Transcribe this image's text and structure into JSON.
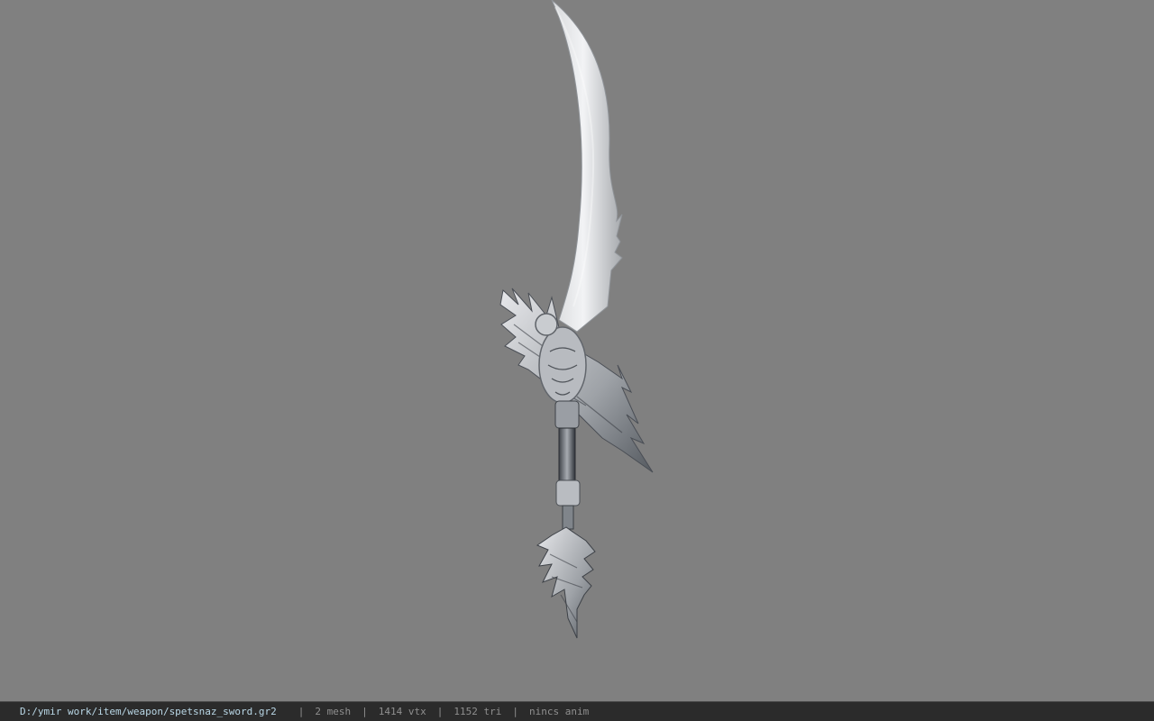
{
  "viewer": {
    "background_color": "#808080",
    "model_name": "spetsnaz_sword",
    "model_icon": "sword-model"
  },
  "status": {
    "path": "D:/ymir work/item/weapon/spetsnaz_sword.gr2",
    "separator": "|",
    "mesh": "2 mesh",
    "vtx": "1414 vtx",
    "tri": "1152 tri",
    "anim": "nincs anim",
    "path_color": "#b9d7e6",
    "text_color": "#8f8f8f",
    "bar_color": "#2b2b2b"
  }
}
